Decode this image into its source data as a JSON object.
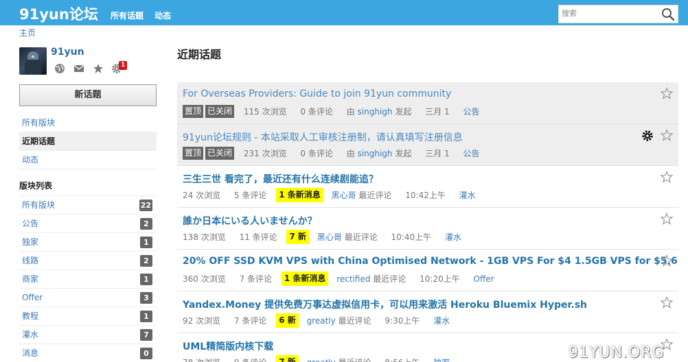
{
  "header": {
    "brand": "91yun论坛",
    "nav": [
      "所有话题",
      "动态"
    ],
    "search_placeholder": "搜索"
  },
  "breadcrumb": "主页",
  "user": {
    "name": "91yun",
    "notification_count": "1"
  },
  "sidebar": {
    "new_topic_label": "新话题",
    "nav": [
      {
        "label": "所有版块",
        "active": false
      },
      {
        "label": "近期话题",
        "active": true
      },
      {
        "label": "动态",
        "active": false
      }
    ],
    "categories_title": "版块列表",
    "categories": [
      {
        "label": "所有版块",
        "count": "22"
      },
      {
        "label": "公告",
        "count": "2"
      },
      {
        "label": "独家",
        "count": "1"
      },
      {
        "label": "线路",
        "count": "2"
      },
      {
        "label": "商家",
        "count": "1"
      },
      {
        "label": "Offer",
        "count": "3"
      },
      {
        "label": "教程",
        "count": "1"
      },
      {
        "label": "灌水",
        "count": "7"
      },
      {
        "label": "消息",
        "count": "0"
      }
    ]
  },
  "main": {
    "title": "近期话题",
    "topics": [
      {
        "title": "For Overseas Providers: Guide to join 91yun community",
        "pinned": true,
        "tags": [
          "置顶",
          "已关闭"
        ],
        "views": "115 次浏览",
        "comments": "0 条评论",
        "author_prefix": "由",
        "author": "singhigh",
        "author_suffix": "发起",
        "date": "三月 1",
        "category": "公告",
        "new": "",
        "gear": false
      },
      {
        "title": "91yun论坛规则 - 本站采取人工审核注册制，请认真填写注册信息",
        "pinned": true,
        "tags": [
          "置顶",
          "已关闭"
        ],
        "views": "231 次浏览",
        "comments": "0 条评论",
        "author_prefix": "由",
        "author": "singhigh",
        "author_suffix": "发起",
        "date": "三月 1",
        "category": "公告",
        "new": "",
        "gear": true
      },
      {
        "title": "三生三世 看完了，最近还有什么连续剧能追？",
        "pinned": false,
        "tags": [],
        "views": "24 次浏览",
        "comments": "5 条评论",
        "new": "1 条新消息",
        "author_prefix": "",
        "author": "黑心哥",
        "author_suffix": "最近评论",
        "date": "10:42上午",
        "category": "灌水",
        "gear": false
      },
      {
        "title": "誰か日本にいる人いませんか？",
        "pinned": false,
        "tags": [],
        "views": "138 次浏览",
        "comments": "11 条评论",
        "new": "7 新",
        "author_prefix": "",
        "author": "黑心哥",
        "author_suffix": "最近评论",
        "date": "10:40上午",
        "category": "灌水",
        "gear": false
      },
      {
        "title": "20% OFF SSD KVM VPS with China Optimised Network - 1GB VPS For $4 1.5GB VPS for $5.6",
        "pinned": false,
        "tags": [],
        "views": "360 次浏览",
        "comments": "7 条评论",
        "new": "1 条新消息",
        "author_prefix": "",
        "author": "rectified",
        "author_suffix": "最近评论",
        "date": "10:20上午",
        "category": "Offer",
        "gear": false
      },
      {
        "title": "Yandex.Money 提供免费万事达虚拟信用卡，可以用来激活 Heroku Bluemix Hyper.sh",
        "pinned": false,
        "tags": [],
        "views": "92 次浏览",
        "comments": "7 条评论",
        "new": "6 新",
        "author_prefix": "",
        "author": "greatly",
        "author_suffix": "最近评论",
        "date": "9:30上午",
        "category": "灌水",
        "gear": false
      },
      {
        "title": "UML精简版内核下载",
        "pinned": false,
        "tags": [],
        "views": "78 次浏览",
        "comments": "9 条评论",
        "new": "7 新",
        "author_prefix": "",
        "author": "greatly",
        "author_suffix": "最近评论",
        "date": "8:56上午",
        "category": "独家",
        "gear": false
      }
    ]
  },
  "watermark": "91YUN.ORG",
  "colors": {
    "header": "#3ba6e0",
    "link": "#2e6da4",
    "new_highlight": "#ffff00",
    "badge": "#d7141e"
  }
}
